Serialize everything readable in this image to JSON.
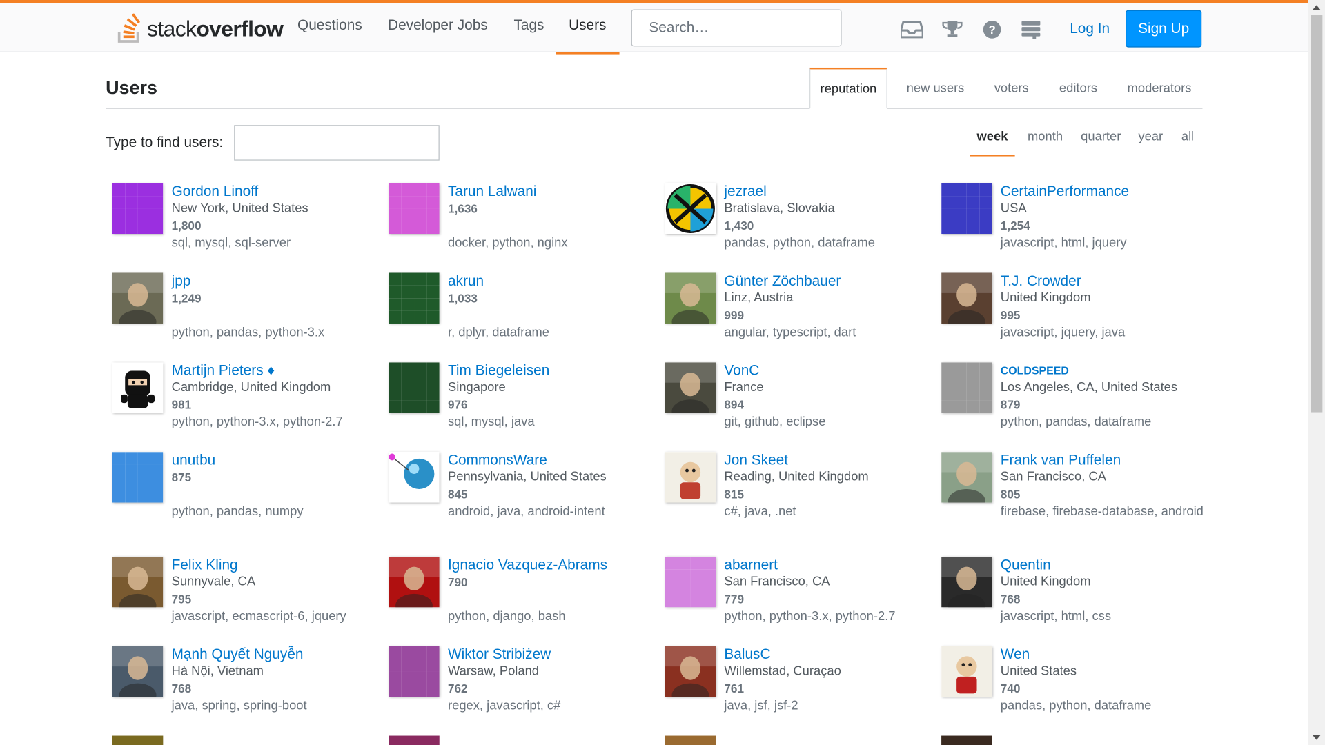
{
  "topbar": {
    "logo_light": "stack",
    "logo_bold": "overflow",
    "nav": [
      "Questions",
      "Developer Jobs",
      "Tags",
      "Users"
    ],
    "search_placeholder": "Search…",
    "login": "Log In",
    "signup": "Sign Up",
    "icons": [
      "inbox-icon",
      "trophy-icon",
      "help-icon",
      "site-switcher-icon"
    ]
  },
  "header": {
    "title": "Users",
    "tabs": [
      "reputation",
      "new users",
      "voters",
      "editors",
      "moderators"
    ],
    "active_tab": "reputation"
  },
  "filter": {
    "label": "Type to find users:",
    "value": "",
    "periods": [
      "week",
      "month",
      "quarter",
      "year",
      "all"
    ],
    "active_period": "week"
  },
  "users": [
    {
      "name": "Gordon Linoff",
      "location": "New York, United States",
      "rep": "1,800",
      "tags": "sql, mysql, sql-server",
      "avatar": "identicon",
      "color": "#9b2fe0"
    },
    {
      "name": "Tarun Lalwani",
      "location": "",
      "rep": "1,636",
      "tags": "docker, python, nginx",
      "avatar": "identicon",
      "color": "#d45ad8"
    },
    {
      "name": "jezrael",
      "location": "Bratislava, Slovakia",
      "rep": "1,430",
      "tags": "pandas, python, dataframe",
      "avatar": "geocache",
      "color": "#1a1a1a"
    },
    {
      "name": "CertainPerformance",
      "location": "USA",
      "rep": "1,254",
      "tags": "javascript, html, jquery",
      "avatar": "identicon",
      "color": "#3b3cc4"
    },
    {
      "name": "jpp",
      "location": "",
      "rep": "1,249",
      "tags": "python, pandas, python-3.x",
      "avatar": "photo",
      "color": "#6b6a55"
    },
    {
      "name": "akrun",
      "location": "",
      "rep": "1,033",
      "tags": "r, dplyr, dataframe",
      "avatar": "identicon",
      "color": "#1f5a2a"
    },
    {
      "name": "Günter Zöchbauer",
      "location": "Linz, Austria",
      "rep": "999",
      "tags": "angular, typescript, dart",
      "avatar": "photo",
      "color": "#6e8a4a"
    },
    {
      "name": "T.J. Crowder",
      "location": "United Kingdom",
      "rep": "995",
      "tags": "javascript, jquery, java",
      "avatar": "photo",
      "color": "#5a4030"
    },
    {
      "name": "Martijn Pieters ♦",
      "location": "Cambridge, United Kingdom",
      "rep": "981",
      "tags": "python, python-3.x, python-2.7",
      "avatar": "ninja",
      "color": "#1a1a1a"
    },
    {
      "name": "Tim Biegeleisen",
      "location": "Singapore",
      "rep": "976",
      "tags": "sql, mysql, java",
      "avatar": "identicon",
      "color": "#1e4e28"
    },
    {
      "name": "VonC",
      "location": "France",
      "rep": "894",
      "tags": "git, github, eclipse",
      "avatar": "photo",
      "color": "#4a4a3e"
    },
    {
      "name": "COLDSPEED",
      "location": "Los Angeles, CA, United States",
      "rep": "879",
      "tags": "python, pandas, dataframe",
      "avatar": "identicon",
      "color": "#9a9a9a"
    },
    {
      "name": "unutbu",
      "location": "",
      "rep": "875",
      "tags": "python, pandas, numpy",
      "avatar": "identicon",
      "color": "#3d8ee0"
    },
    {
      "name": "CommonsWare",
      "location": "Pennsylvania, United States",
      "rep": "845",
      "tags": "android, java, android-intent",
      "avatar": "commonsware",
      "color": "#2a90c8"
    },
    {
      "name": "Jon Skeet",
      "location": "Reading, United Kingdom",
      "rep": "815",
      "tags": "c#, java, .net",
      "avatar": "cartoon",
      "color": "#c04030"
    },
    {
      "name": "Frank van Puffelen",
      "location": "San Francisco, CA",
      "rep": "805",
      "tags": "firebase, firebase-database, android",
      "avatar": "photo",
      "color": "#8aa088"
    },
    {
      "name": "Felix Kling",
      "location": "Sunnyvale, CA",
      "rep": "795",
      "tags": "javascript, ecmascript-6, jquery",
      "avatar": "photo",
      "color": "#7a5a30"
    },
    {
      "name": "Ignacio Vazquez-Abrams",
      "location": "",
      "rep": "790",
      "tags": "python, django, bash",
      "avatar": "photo",
      "color": "#b01010"
    },
    {
      "name": "abarnert",
      "location": "San Francisco, CA",
      "rep": "779",
      "tags": "python, python-3.x, python-2.7",
      "avatar": "identicon",
      "color": "#d484e0"
    },
    {
      "name": "Quentin",
      "location": "United Kingdom",
      "rep": "768",
      "tags": "javascript, html, css",
      "avatar": "photo",
      "color": "#2a2a2a"
    },
    {
      "name": "Mạnh Quyết Nguyễn",
      "location": "Hà Nội, Vietnam",
      "rep": "768",
      "tags": "java, spring, spring-boot",
      "avatar": "photo",
      "color": "#4a5a6a"
    },
    {
      "name": "Wiktor Stribiżew",
      "location": "Warsaw, Poland",
      "rep": "762",
      "tags": "regex, javascript, c#",
      "avatar": "identicon",
      "color": "#9a4aa0"
    },
    {
      "name": "BalusC",
      "location": "Willemstad, Curaçao",
      "rep": "761",
      "tags": "java, jsf, jsf-2",
      "avatar": "photo",
      "color": "#8a3020"
    },
    {
      "name": "Wen",
      "location": "United States",
      "rep": "740",
      "tags": "pandas, python, dataframe",
      "avatar": "cartoon",
      "color": "#c02020"
    }
  ],
  "colors": {
    "accent": "#f48024",
    "link": "#0077cc",
    "button": "#0095ff"
  }
}
